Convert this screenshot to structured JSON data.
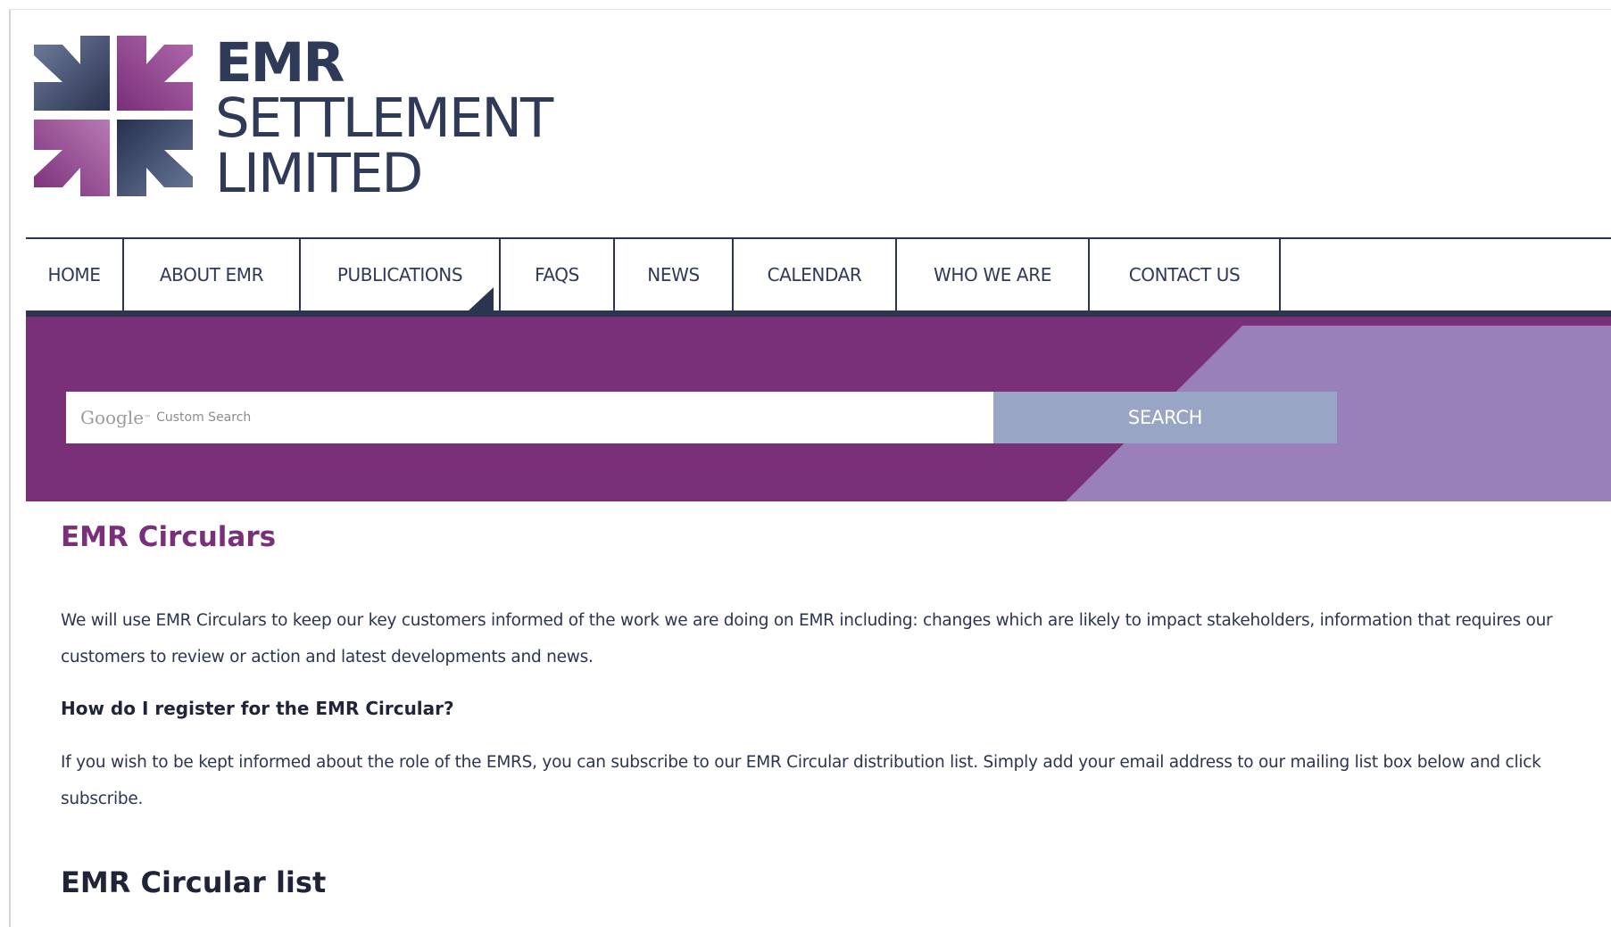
{
  "brand": {
    "logo_lines": [
      "EMR",
      "SETTLEMENT",
      "LIMITED"
    ],
    "colors": {
      "navy": "#2c3550",
      "purple": "#7a2f79",
      "lilac": "#9a80bb",
      "slate_blue": "#98a5c4"
    }
  },
  "nav": {
    "items": [
      {
        "label": "HOME"
      },
      {
        "label": "ABOUT EMR"
      },
      {
        "label": "PUBLICATIONS"
      },
      {
        "label": "FAQS"
      },
      {
        "label": "NEWS"
      },
      {
        "label": "CALENDAR"
      },
      {
        "label": "WHO WE ARE"
      },
      {
        "label": "CONTACT US"
      }
    ],
    "active": "PUBLICATIONS"
  },
  "search": {
    "placeholder_brand": "Google",
    "placeholder_tm": "™",
    "placeholder_text": "Custom Search",
    "button_label": "SEARCH"
  },
  "main": {
    "title": "EMR Circulars",
    "intro": "We will use EMR Circulars to keep our key customers informed of the work we are doing on EMR including: changes which are likely to impact stakeholders, information that requires our customers to review or action and latest developments and news.",
    "register_heading": "How do I register for the EMR Circular?",
    "register_text": "If you wish to be kept informed about the role of the EMRS, you can subscribe to our EMR Circular distribution list. Simply add your email address to our mailing list box below and click subscribe.",
    "list_heading": "EMR Circular list"
  }
}
